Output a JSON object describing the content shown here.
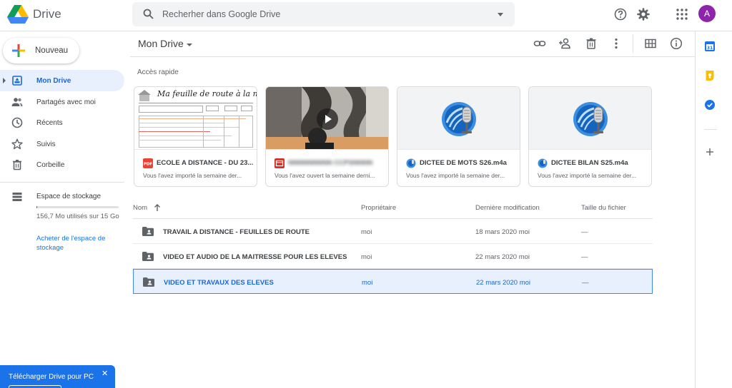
{
  "app": {
    "title": "Drive",
    "avatar_letter": "A",
    "accent": "#1a73e8"
  },
  "search": {
    "placeholder": "Recherher dans Google Drive"
  },
  "new_button": {
    "label": "Nouveau"
  },
  "sidebar": {
    "items": [
      {
        "label": "Mon Drive",
        "icon": "my-drive-icon",
        "active": true
      },
      {
        "label": "Partagés avec moi",
        "icon": "shared-icon"
      },
      {
        "label": "Récents",
        "icon": "clock-icon"
      },
      {
        "label": "Suivis",
        "icon": "star-icon"
      },
      {
        "label": "Corbeille",
        "icon": "trash-icon"
      }
    ],
    "storage": {
      "label": "Espace de stockage",
      "used_text": "156,7 Mo utilisés sur 15 Go",
      "used_fraction": 0.01,
      "buy_link": "Acheter de l'espace de stockage"
    }
  },
  "main": {
    "title": "Mon Drive",
    "quick_access_label": "Accès rapide",
    "quick_cards": [
      {
        "name": "ECOLE A DISTANCE - DU 23...",
        "subtitle": "Vous l'avez importé la semaine der...",
        "type": "pdf",
        "thumb_text": "Ma feuille de route à la maison"
      },
      {
        "name": "NNNNNNNNN CCPSNNNN",
        "subtitle": "Vous l'avez ouvert la semaine derni...",
        "type": "video"
      },
      {
        "name": "DICTEE DE MOTS S26.m4a",
        "subtitle": "Vous l'avez importé la semaine der...",
        "type": "audio"
      },
      {
        "name": "DICTEE BILAN S25.m4a",
        "subtitle": "Vous l'avez importé la semaine der...",
        "type": "audio"
      }
    ],
    "columns": {
      "name": "Nom",
      "owner": "Propriétaire",
      "modified": "Dernière modification",
      "size": "Taille du fichier"
    },
    "rows": [
      {
        "name": "TRAVAIL A DISTANCE - FEUILLES DE ROUTE",
        "owner": "moi",
        "modified": "18 mars 2020",
        "modified_by": "moi",
        "size": "—"
      },
      {
        "name": "VIDEO ET AUDIO DE LA MAITRESSE POUR LES ELEVES",
        "owner": "moi",
        "modified": "22 mars 2020",
        "modified_by": "moi",
        "size": "—"
      },
      {
        "name": "VIDEO ET TRAVAUX DES ELEVES",
        "owner": "moi",
        "modified": "22 mars 2020",
        "modified_by": "moi",
        "size": "—",
        "selected": true
      }
    ]
  },
  "banner": {
    "text": "Télécharger Drive pour PC",
    "close": "✕"
  }
}
